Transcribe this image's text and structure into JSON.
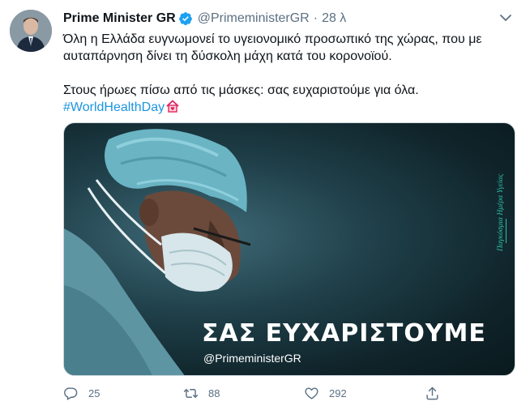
{
  "author": {
    "display_name": "Prime Minister GR",
    "handle": "@PrimeministerGR",
    "separator": "·",
    "time": "28 λ",
    "verified": true
  },
  "tweet": {
    "line1": "Όλη η Ελλάδα ευγνωμονεί το υγειονομικό προσωπικό της χώρας, που με αυταπάρνηση δίνει τη δύσκολη μάχη κατά του κορονοϊού.",
    "line2": "Στους ήρωες πίσω από τις μάσκες: σας ευχαριστούμε για όλα.",
    "hashtag": "#WorldHealthDay",
    "hashtag_emoji": "house-with-heart-icon"
  },
  "media": {
    "headline": "ΣΑΣ ΕΥΧΑΡΙΣΤΟΥΜΕ",
    "handle": "@PrimeministerGR",
    "vertical_caption": "Παγκόσμια Ημέρα Υγείας",
    "accent_color": "#2fc0a8"
  },
  "actions": {
    "reply_count": "25",
    "retweet_count": "88",
    "like_count": "292"
  },
  "colors": {
    "link": "#1b95e0",
    "muted": "#5b7083",
    "verified_badge": "#1da1f2"
  }
}
